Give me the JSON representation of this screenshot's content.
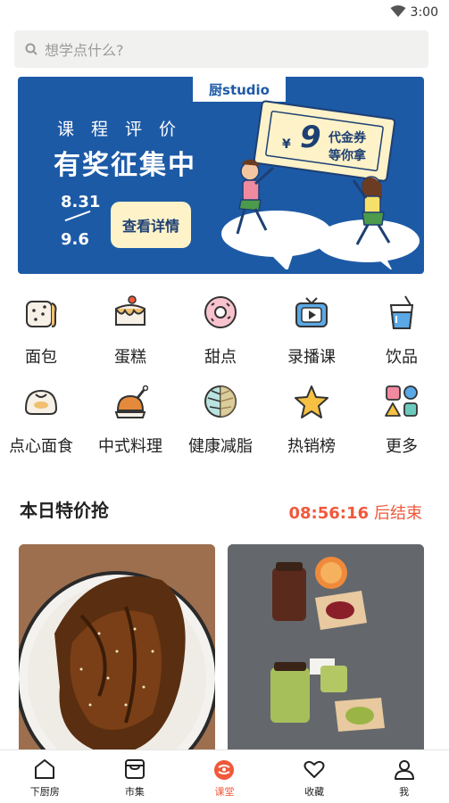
{
  "status_bar": {
    "time": "3:00",
    "wifi_icon": "wifi-icon"
  },
  "search": {
    "placeholder": "想学点什么?"
  },
  "banner": {
    "brand": "厨studio",
    "kicker": "课程评价",
    "headline": "有奖征集中",
    "date_start": "8.31",
    "date_end": "9.6",
    "cta_label": "查看详情",
    "coupon_yen": "¥",
    "coupon_amount": "9",
    "coupon_line1": "代金券",
    "coupon_line2": "等你拿"
  },
  "categories": [
    {
      "label": "面包",
      "icon": "bread-icon"
    },
    {
      "label": "蛋糕",
      "icon": "cake-icon"
    },
    {
      "label": "甜点",
      "icon": "donut-icon"
    },
    {
      "label": "录播课",
      "icon": "tv-play-icon"
    },
    {
      "label": "饮品",
      "icon": "drink-icon"
    },
    {
      "label": "点心面食",
      "icon": "steamed-bun-icon"
    },
    {
      "label": "中式料理",
      "icon": "roast-chicken-icon"
    },
    {
      "label": "健康减脂",
      "icon": "leaf-icon"
    },
    {
      "label": "热销榜",
      "icon": "star-icon"
    },
    {
      "label": "更多",
      "icon": "shapes-icon"
    }
  ],
  "deals": {
    "title": "本日特价抢",
    "countdown_time": "08:56:16",
    "countdown_suffix": "后结束"
  },
  "tabbar": [
    {
      "label": "下厨房",
      "icon": "home-icon",
      "active": false
    },
    {
      "label": "市集",
      "icon": "market-icon",
      "active": false
    },
    {
      "label": "课堂",
      "icon": "classroom-icon",
      "active": true
    },
    {
      "label": "收藏",
      "icon": "heart-icon",
      "active": false
    },
    {
      "label": "我",
      "icon": "user-icon",
      "active": false
    }
  ],
  "colors": {
    "accent": "#f0593b",
    "banner_blue": "#1d5aa6"
  }
}
